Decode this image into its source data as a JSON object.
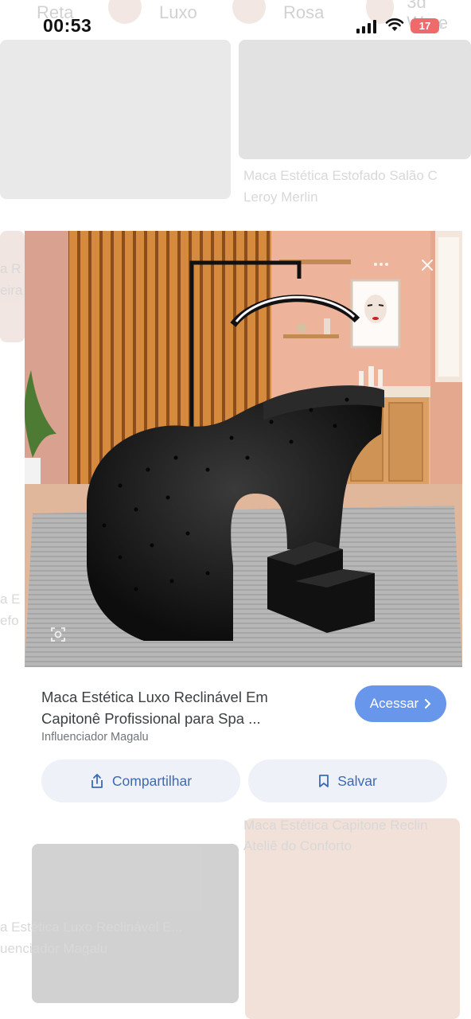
{
  "status_bar": {
    "time": "00:53",
    "battery": "17"
  },
  "background": {
    "chips": [
      "Reta",
      "Luxo",
      "Rosa",
      "3d Ware"
    ],
    "right_top_title": "Maca Estética Estofado Salão C",
    "right_top_source": "Leroy Merlin",
    "left_mid_1": "a R",
    "left_mid_2": "eira",
    "left_low_1": "a E",
    "left_low_2": "efo",
    "right_bottom_title": "Maca Estética Capitone Reclin",
    "right_bottom_source": "Ateliê do Conforto",
    "left_bottom_title": "a Estética Luxo Reclinável E...",
    "left_bottom_source": "uenciador Magalu"
  },
  "preview": {
    "title": "Maca Estética Luxo Reclinável Em\nCapitonê Profissional para Spa ...",
    "source": "Influenciador Magalu",
    "visit_label": "Acessar",
    "share_label": "Compartilhar",
    "save_label": "Salvar"
  },
  "colors": {
    "accent": "#3e79e6",
    "action_bg": "#eef1f7",
    "action_text": "#3b6ab8",
    "title_text": "#3c4043",
    "battery": "#ef6a6a"
  }
}
